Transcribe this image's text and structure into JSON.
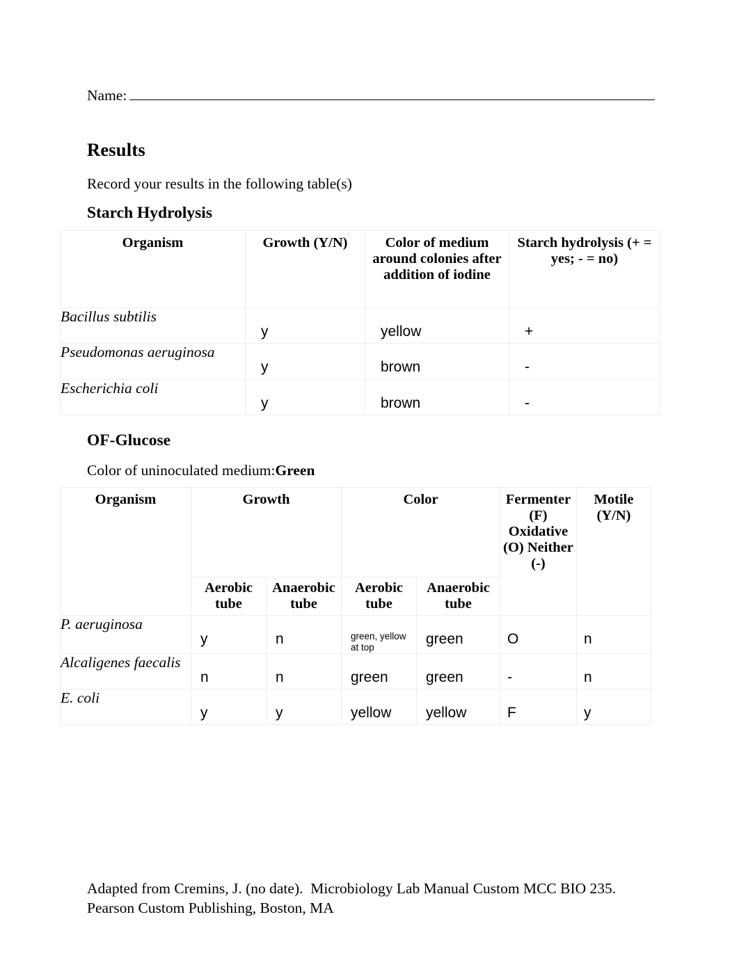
{
  "name_line": {
    "label": "Name:"
  },
  "headings": {
    "results": "Results",
    "intro": "Record your results in the following table(s)",
    "starch": "Starch Hydrolysis",
    "of_glucose": "OF-Glucose"
  },
  "uninoculated": {
    "label": "Color of uninoculated medium:",
    "value": "Green"
  },
  "starch_table": {
    "headers": {
      "organism": "Organism",
      "growth": "Growth (Y/N)",
      "color": "Color of medium around colonies after addition of iodine",
      "hydrolysis": "Starch hydrolysis (+ = yes; - = no)"
    },
    "rows": [
      {
        "organism": "Bacillus subtilis",
        "growth": "y",
        "color": "yellow",
        "hydrolysis": "+"
      },
      {
        "organism": "Pseudomonas aeruginosa",
        "growth": "y",
        "color": "brown",
        "hydrolysis": "-"
      },
      {
        "organism": "Escherichia coli",
        "growth": "y",
        "color": "brown",
        "hydrolysis": "-"
      }
    ]
  },
  "of_table": {
    "headers": {
      "organism": "Organism",
      "growth": "Growth",
      "color": "Color",
      "fermenter": "Fermenter (F) Oxidative (O) Neither (-)",
      "motile": "Motile (Y/N)",
      "growth_aerobic": "Aerobic tube",
      "growth_anaerobic": "Anaerobic tube",
      "color_aerobic": "Aerobic tube",
      "color_anaerobic": "Anaerobic tube"
    },
    "rows": [
      {
        "organism": "P. aeruginosa",
        "growth_aerobic": "y",
        "growth_anaerobic": "n",
        "color_aerobic": "green, yellow at top",
        "color_aerobic_small": true,
        "color_anaerobic": "green",
        "fermenter": "O",
        "motile": "n"
      },
      {
        "organism": "Alcaligenes faecalis",
        "growth_aerobic": "n",
        "growth_anaerobic": "n",
        "color_aerobic": "green",
        "color_aerobic_small": false,
        "color_anaerobic": "green",
        "fermenter": "-",
        "motile": "n"
      },
      {
        "organism": "E. coli",
        "growth_aerobic": "y",
        "growth_anaerobic": "y",
        "color_aerobic": "yellow",
        "color_aerobic_small": false,
        "color_anaerobic": "yellow",
        "fermenter": "F",
        "motile": "y"
      }
    ]
  },
  "footer": {
    "line1": "Adapted from Cremins, J. (no date).  Microbiology Lab Manual Custom MCC BIO 235.",
    "line2": "Pearson Custom Publishing, Boston, MA"
  }
}
